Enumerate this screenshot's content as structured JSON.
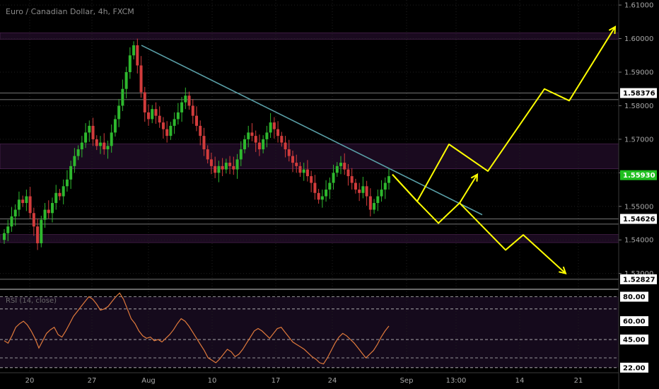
{
  "chart_data": {
    "type": "candlestick",
    "title": "Euro / Canadian Dollar, 4h, FXCM",
    "price_axis": {
      "range": [
        1.5255,
        1.6115
      ],
      "ticks": [
        1.53,
        1.54,
        1.55,
        1.56,
        1.57,
        1.58,
        1.59,
        1.6,
        1.61
      ],
      "tick_labels": [
        "1.53000",
        "1.54000",
        "1.55000",
        "1.56000",
        "1.57000",
        "1.58000",
        "1.59000",
        "1.60000",
        "1.61000"
      ]
    },
    "date_axis": {
      "ticks": [
        0,
        20,
        40,
        60,
        80,
        100,
        120,
        140,
        160,
        180,
        200,
        220
      ],
      "tick_labels": [
        "20",
        "27",
        "Aug",
        "10",
        "17",
        "24",
        "Sep",
        "13:00",
        "14",
        "21"
      ]
    },
    "price_badges": [
      {
        "value": "1.58376",
        "price": 1.58376,
        "style": "white"
      },
      {
        "value": "1.55930",
        "price": 1.5593,
        "style": "green"
      },
      {
        "value": "1.54626",
        "price": 1.54626,
        "style": "white"
      },
      {
        "value": "1.52827",
        "price": 1.52827,
        "style": "white"
      }
    ],
    "candles_close": [
      1.542,
      1.544,
      1.547,
      1.549,
      1.552,
      1.551,
      1.553,
      1.548,
      1.544,
      1.539,
      1.546,
      1.549,
      1.548,
      1.551,
      1.554,
      1.553,
      1.556,
      1.558,
      1.562,
      1.565,
      1.567,
      1.569,
      1.572,
      1.574,
      1.57,
      1.568,
      1.569,
      1.567,
      1.568,
      1.572,
      1.576,
      1.58,
      1.585,
      1.59,
      1.595,
      1.598,
      1.592,
      1.584,
      1.578,
      1.576,
      1.579,
      1.577,
      1.575,
      1.573,
      1.571,
      1.574,
      1.576,
      1.578,
      1.581,
      1.583,
      1.58,
      1.577,
      1.574,
      1.571,
      1.567,
      1.564,
      1.562,
      1.56,
      1.562,
      1.561,
      1.563,
      1.562,
      1.561,
      1.564,
      1.567,
      1.57,
      1.572,
      1.571,
      1.569,
      1.567,
      1.57,
      1.572,
      1.575,
      1.573,
      1.571,
      1.569,
      1.567,
      1.565,
      1.563,
      1.562,
      1.56,
      1.561,
      1.559,
      1.557,
      1.554,
      1.552,
      1.553,
      1.555,
      1.557,
      1.56,
      1.562,
      1.563,
      1.561,
      1.559,
      1.557,
      1.555,
      1.554,
      1.556,
      1.553,
      1.549,
      1.551,
      1.553,
      1.555,
      1.557,
      1.559
    ],
    "rsi_label": "RSI (14, close)",
    "rsi_axis": {
      "range": [
        19.0,
        85.5
      ],
      "ticks": [
        22,
        45,
        60,
        80
      ],
      "tick_labels": [
        "22.00",
        "45.00",
        "60.00",
        "80.00"
      ]
    },
    "rsi_values": [
      44,
      42,
      48,
      55,
      58,
      60,
      57,
      52,
      46,
      38,
      44,
      50,
      53,
      55,
      49,
      47,
      52,
      58,
      64,
      68,
      72,
      76,
      80,
      78,
      74,
      69,
      70,
      72,
      76,
      80,
      83,
      78,
      70,
      62,
      58,
      52,
      48,
      46,
      47,
      44,
      45,
      43,
      46,
      49,
      53,
      58,
      62,
      60,
      56,
      51,
      46,
      41,
      36,
      30,
      28,
      26,
      29,
      33,
      37,
      35,
      31,
      33,
      37,
      42,
      47,
      52,
      54,
      52,
      49,
      46,
      50,
      54,
      55,
      51,
      47,
      43,
      41,
      39,
      37,
      34,
      31,
      29,
      26,
      25,
      30,
      36,
      42,
      47,
      50,
      48,
      45,
      42,
      38,
      34,
      30,
      33,
      36,
      41,
      47,
      52,
      56
    ]
  },
  "colors": {
    "background": "#000000",
    "candle_up": "#2eb82e",
    "candle_down": "#d23c3c",
    "trendline": "#5aa0a8",
    "projection_arrows": "#ffff00",
    "zone_fill": "#1a0a1f",
    "rsi_line": "#e07a3c",
    "axis_text": "#a8a8a8",
    "badge_green": "#1fbf1f"
  }
}
